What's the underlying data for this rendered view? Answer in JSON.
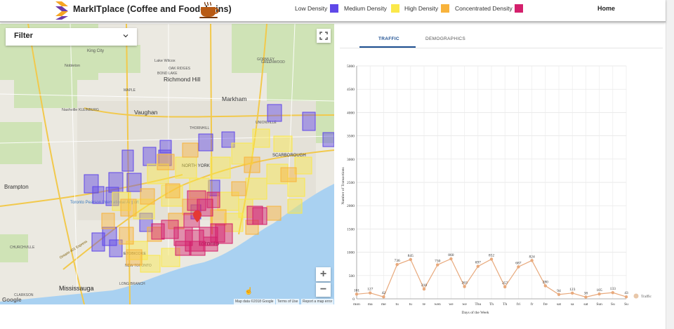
{
  "header": {
    "app_title": "MarkITplace (Coffee and Foodchains)",
    "home_label": "Home",
    "legend": [
      {
        "label": "Low Density",
        "color": "#5f48e8"
      },
      {
        "label": "Medium Density",
        "color": "#fbe84a"
      },
      {
        "label": "High Density",
        "color": "#f8b33c"
      },
      {
        "label": "Concentrated Density",
        "color": "#d4206c"
      }
    ]
  },
  "filter": {
    "label": "Filter"
  },
  "map": {
    "labels": {
      "king_city": "King City",
      "nobleton": "Nobleton",
      "lake_wilcox": "Lake Wilcox",
      "oak_ridges": "OAK RIDGES",
      "bond_lake": "BOND LAKE",
      "gormley": "GORMLEY",
      "greenwood": "GREENWOOD",
      "richmond_hill": "Richmond Hill",
      "maple": "MAPLE",
      "nashville": "Nashville",
      "kleinburg": "KLEINBURG",
      "vaughan": "Vaughan",
      "markham": "Markham",
      "unionville": "UNIONVILLE",
      "thornhill": "THORNHILL",
      "north_york": "NORTH YORK",
      "scarborough": "SCARBOROUGH",
      "brampton": "Brampton",
      "airport": "Toronto Pearson International Airport",
      "toronto": "Toronto",
      "etobicoke": "ETOBICOKE",
      "mississauga": "Mississauga",
      "churchville": "CHURCHVILLE",
      "clarkson": "CLARKSON",
      "new_toronto": "NEW TORONTO",
      "long_branch": "LONG BRANCH",
      "highway": "Ontario 401 Express",
      "google": "Google"
    },
    "attribution": {
      "data": "Map data ©2018 Google",
      "terms": "Terms of Use",
      "report": "Report a map error"
    },
    "zoom_in": "+",
    "zoom_out": "−"
  },
  "tabs": [
    {
      "label": "TRAFFIC",
      "active": true
    },
    {
      "label": "DEMOGRAPHICS",
      "active": false
    }
  ],
  "chart_data": {
    "type": "line",
    "title": "",
    "xlabel": "Days of the Week",
    "ylabel": "Number of Transactions",
    "ylim": [
      0,
      5000
    ],
    "y_ticks": [
      0,
      500,
      1000,
      1500,
      2000,
      2500,
      3000,
      3500,
      4000,
      4500,
      5000
    ],
    "categories": [
      "mon",
      "ma",
      "me",
      "tu",
      "tu",
      "te",
      "wen",
      "we",
      "we",
      "Thu",
      "Th",
      "Th",
      "fri",
      "fr",
      "fre",
      "sat",
      "sa",
      "sat",
      "Sun",
      "Su",
      "Su"
    ],
    "series": [
      {
        "name": "Traffic",
        "values": [
          101,
          127,
          42,
          736,
          845,
          210,
          730,
          860,
          263,
          697,
          852,
          257,
          687,
          824,
          280,
          94,
          123,
          38,
          105,
          133,
          43
        ],
        "color": "#e8a97c"
      }
    ],
    "grid": true,
    "legend_position": "right"
  }
}
